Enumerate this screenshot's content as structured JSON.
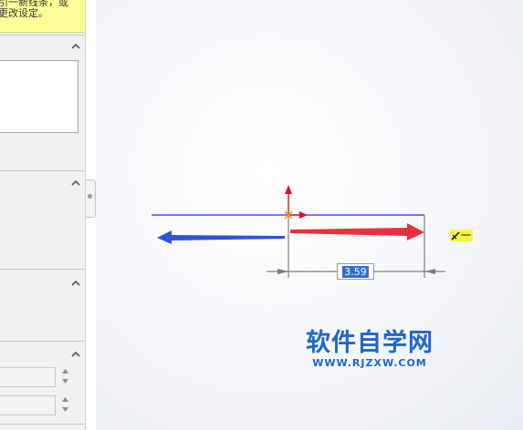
{
  "message": {
    "line1": "引一新线条，或",
    "line2": "更改设定。"
  },
  "dimension": {
    "value": "3.59"
  },
  "relation": {
    "label": "一"
  },
  "watermark": {
    "title": "软件自学网",
    "url": "WWW.RJZXW.COM"
  },
  "colors": {
    "sketch_line": "#2b2bd6",
    "arrow_left": "#2a55d8",
    "arrow_right": "#e8313a",
    "origin_arrow": "#d8141c",
    "dimension_line": "#7d7d7d",
    "message_bg": "#ffff99",
    "relation_bg": "#f5f545",
    "watermark": "#1f66c8"
  },
  "icons": [
    "chevron-up-icon",
    "origin-icon",
    "horizontal-relation-icon",
    "spin-up-icon",
    "spin-down-icon"
  ]
}
